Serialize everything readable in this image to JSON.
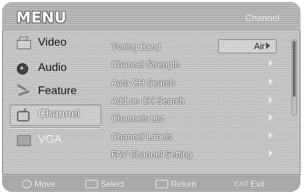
{
  "header": {
    "title": "MENU",
    "context": "Channel"
  },
  "sidebar": {
    "items": [
      {
        "label": "Video",
        "icon": "video-icon"
      },
      {
        "label": "Audio",
        "icon": "audio-icon"
      },
      {
        "label": "Feature",
        "icon": "feature-icon"
      },
      {
        "label": "Channel",
        "icon": "channel-icon",
        "active": true
      },
      {
        "label": "VGA",
        "icon": "vga-icon",
        "dimmed": true
      }
    ]
  },
  "channel_menu": {
    "rows": [
      {
        "label": "Tuning Band",
        "value": "Air"
      },
      {
        "label": "Channel Strength"
      },
      {
        "label": "Auto CH Search"
      },
      {
        "label": "Add on CH Search"
      },
      {
        "label": "Channels List"
      },
      {
        "label": "Channel Labels"
      },
      {
        "label": "FAV Channel Setting"
      }
    ]
  },
  "footer": {
    "move": "Move",
    "select": "Select",
    "return_label": "Return",
    "exit_key": "EXIT",
    "exit": "Exit"
  }
}
